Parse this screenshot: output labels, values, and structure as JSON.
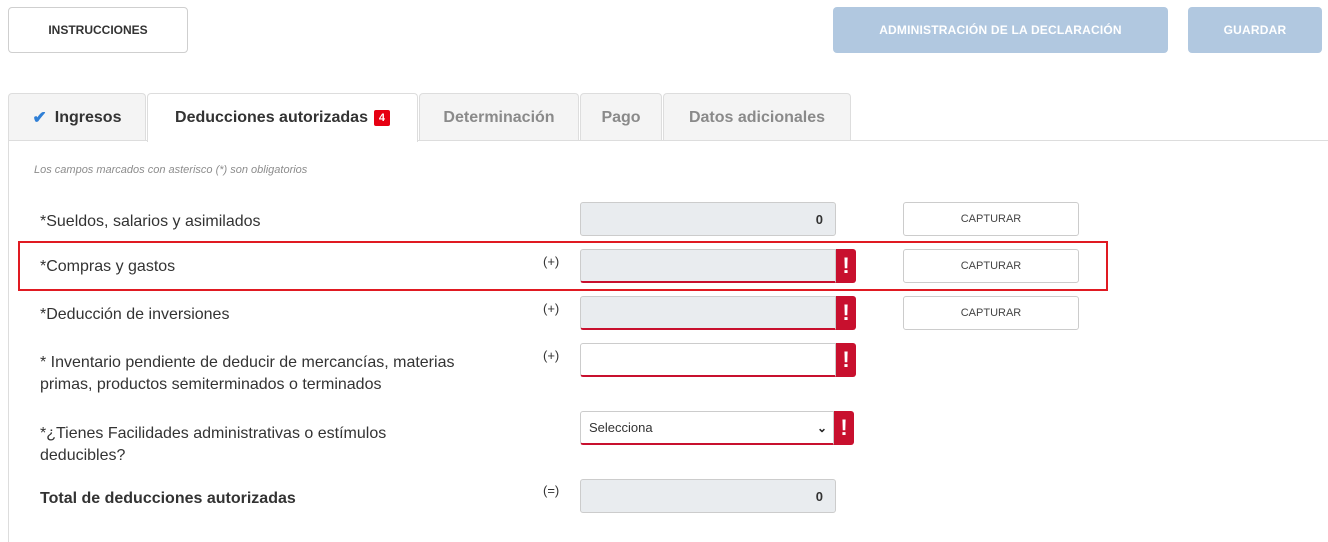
{
  "toolbar": {
    "instructions_label": "INSTRUCCIONES",
    "admin_label": "ADMINISTRACIÓN DE LA DECLARACIÓN",
    "save_label": "GUARDAR"
  },
  "tabs": [
    {
      "label": "Ingresos",
      "state": "completed",
      "icon": "check-icon"
    },
    {
      "label": "Deducciones autorizadas",
      "state": "active",
      "badge": "4"
    },
    {
      "label": "Determinación",
      "state": "disabled"
    },
    {
      "label": "Pago",
      "state": "disabled"
    },
    {
      "label": "Datos adicionales",
      "state": "disabled"
    }
  ],
  "form": {
    "required_note": "Los campos marcados con asterisco (*) son obligatorios",
    "rows": [
      {
        "label": "*Sueldos, salarios y asimilados",
        "sign": "",
        "value": "0",
        "button": "CAPTURAR"
      },
      {
        "label": "*Compras y gastos",
        "sign": "(+)",
        "value": "",
        "button": "CAPTURAR",
        "error": "!"
      },
      {
        "label": "*Deducción de inversiones",
        "sign": "(+)",
        "value": "",
        "button": "CAPTURAR",
        "error": "!"
      },
      {
        "label_line1": "* Inventario pendiente de deducir de mercancías, materias",
        "label_line2": "primas, productos semiterminados o terminados",
        "sign": "(+)",
        "value": "",
        "error": "!"
      },
      {
        "label_line1": "*¿Tienes Facilidades administrativas o estímulos",
        "label_line2": "deducibles?",
        "select_value": "Selecciona",
        "error": "!"
      },
      {
        "label": "Total de deducciones autorizadas",
        "sign": "(=)",
        "value": "0"
      }
    ]
  },
  "colors": {
    "accent_disabled_button": "#b1c8e0",
    "error_red": "#c8102e",
    "highlight_red": "#e01a22",
    "check_blue": "#2f7fd6"
  }
}
